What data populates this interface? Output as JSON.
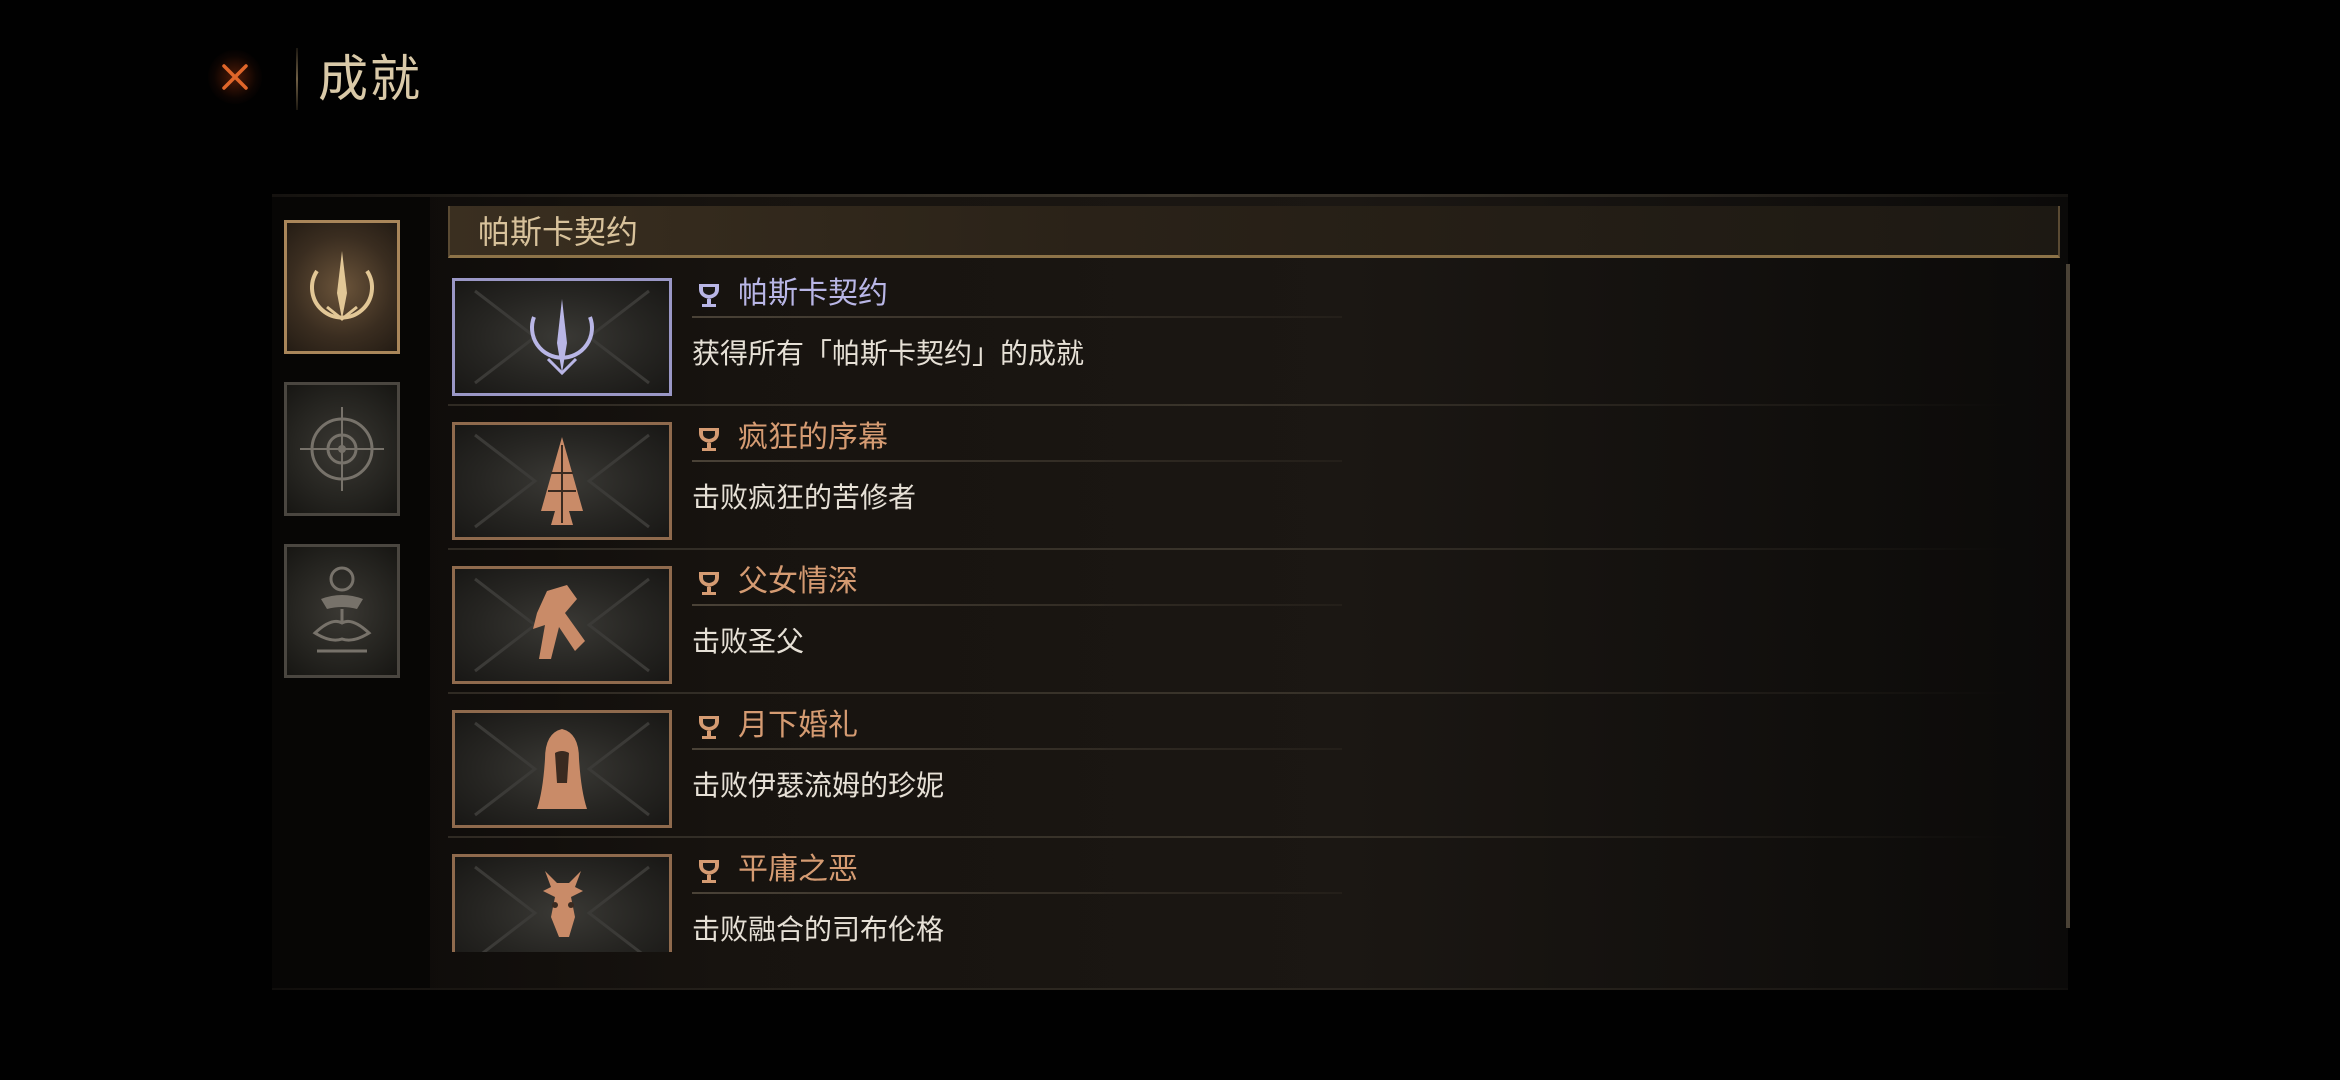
{
  "header": {
    "title": "成就"
  },
  "colors": {
    "name_unlocked": "#b9b6e6",
    "name_locked": "#d59b72",
    "active_tab_border": "#a9865a",
    "section_underline": "#8d7348"
  },
  "sidebar": {
    "tabs": [
      {
        "icon": "crescent-spire-icon",
        "active": true
      },
      {
        "icon": "compass-eye-icon",
        "active": false
      },
      {
        "icon": "ritual-figure-icon",
        "active": false
      }
    ]
  },
  "section": {
    "title": "帕斯卡契约"
  },
  "achievements": [
    {
      "name": "帕斯卡契约",
      "desc": "获得所有「帕斯卡契约」的成就",
      "icon": "crescent-spire-icon",
      "state": "unlocked"
    },
    {
      "name": "疯狂的序幕",
      "desc": "击败疯狂的苦修者",
      "icon": "thorn-spire-icon",
      "state": "locked"
    },
    {
      "name": "父女情深",
      "desc": "击败圣父",
      "icon": "broken-figure-icon",
      "state": "locked"
    },
    {
      "name": "月下婚礼",
      "desc": "击败伊瑟流姆的珍妮",
      "icon": "veiled-bride-icon",
      "state": "locked"
    },
    {
      "name": "平庸之恶",
      "desc": "击败融合的司布伦格",
      "icon": "antlered-beast-icon",
      "state": "locked"
    }
  ]
}
